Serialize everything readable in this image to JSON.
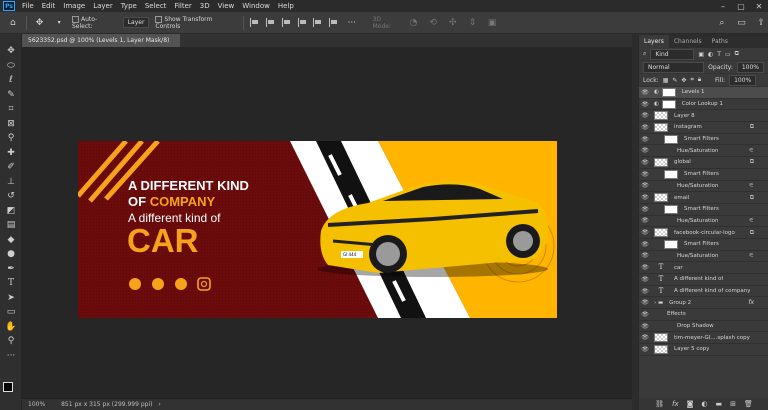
{
  "menu": [
    "File",
    "Edit",
    "Image",
    "Layer",
    "Type",
    "Select",
    "Filter",
    "3D",
    "View",
    "Window",
    "Help"
  ],
  "options": {
    "auto_select_label": "Auto-Select:",
    "layer_dropdown": "Layer",
    "transform_label": "Show Transform Controls",
    "mode_label": "3D Mode:"
  },
  "document": {
    "tab_title": "5623352.psd @ 100% (Levels 1, Layer Mask/8) *",
    "zoom": "100%",
    "dimensions": "851 px x 315 px (299.999 ppi)"
  },
  "artwork": {
    "line1": "A DIFFERENT KIND",
    "line2_a": "OF",
    "line2_b": "COMPANY",
    "line3": "A different kind of",
    "line4": "CAR",
    "plate": "GI 444",
    "colors": {
      "maroon": "#6b0b0b",
      "yellow": "#ffb400",
      "orange": "#f7a21b",
      "white": "#ffffff"
    }
  },
  "panel": {
    "tabs": [
      "Layers",
      "Channels",
      "Paths"
    ],
    "filter_kind": "Kind",
    "blend_mode": "Normal",
    "opacity_label": "Opacity:",
    "opacity_value": "100%",
    "lock_label": "Lock:",
    "fill_label": "Fill:",
    "fill_value": "100%",
    "layers": [
      {
        "name": "Levels 1",
        "type": "adj",
        "indent": 0,
        "selected": true
      },
      {
        "name": "Color Lookup 1",
        "type": "adj",
        "indent": 0
      },
      {
        "name": "Layer 8",
        "type": "img",
        "indent": 0
      },
      {
        "name": "instagram",
        "type": "img",
        "indent": 0,
        "badge": "⧉"
      },
      {
        "name": "Smart Filters",
        "type": "white",
        "indent": 1
      },
      {
        "name": "Hue/Saturation",
        "type": "none",
        "indent": 2,
        "badge": "⚟"
      },
      {
        "name": "global",
        "type": "img",
        "indent": 0,
        "badge": "⧉"
      },
      {
        "name": "Smart Filters",
        "type": "white",
        "indent": 1
      },
      {
        "name": "Hue/Saturation",
        "type": "none",
        "indent": 2,
        "badge": "⚟"
      },
      {
        "name": "email",
        "type": "img",
        "indent": 0,
        "badge": "⧉"
      },
      {
        "name": "Smart Filters",
        "type": "white",
        "indent": 1
      },
      {
        "name": "Hue/Saturation",
        "type": "none",
        "indent": 2,
        "badge": "⚟"
      },
      {
        "name": "facebook-circular-logo",
        "type": "img",
        "indent": 0,
        "badge": "⧉"
      },
      {
        "name": "Smart Filters",
        "type": "white",
        "indent": 1
      },
      {
        "name": "Hue/Saturation",
        "type": "none",
        "indent": 2,
        "badge": "⚟"
      },
      {
        "name": "car",
        "type": "text",
        "indent": 0
      },
      {
        "name": "A different kind of",
        "type": "text",
        "indent": 0
      },
      {
        "name": "A different kind of company",
        "type": "text",
        "indent": 0
      },
      {
        "name": "Group 2",
        "type": "folder",
        "indent": 0,
        "fx": "fx"
      },
      {
        "name": "Effects",
        "type": "none",
        "indent": 1
      },
      {
        "name": "Drop Shadow",
        "type": "none",
        "indent": 2
      },
      {
        "name": "tim-meyer-GI....splash copy",
        "type": "img",
        "indent": 0
      },
      {
        "name": "Layer 5 copy",
        "type": "img",
        "indent": 0
      }
    ]
  }
}
